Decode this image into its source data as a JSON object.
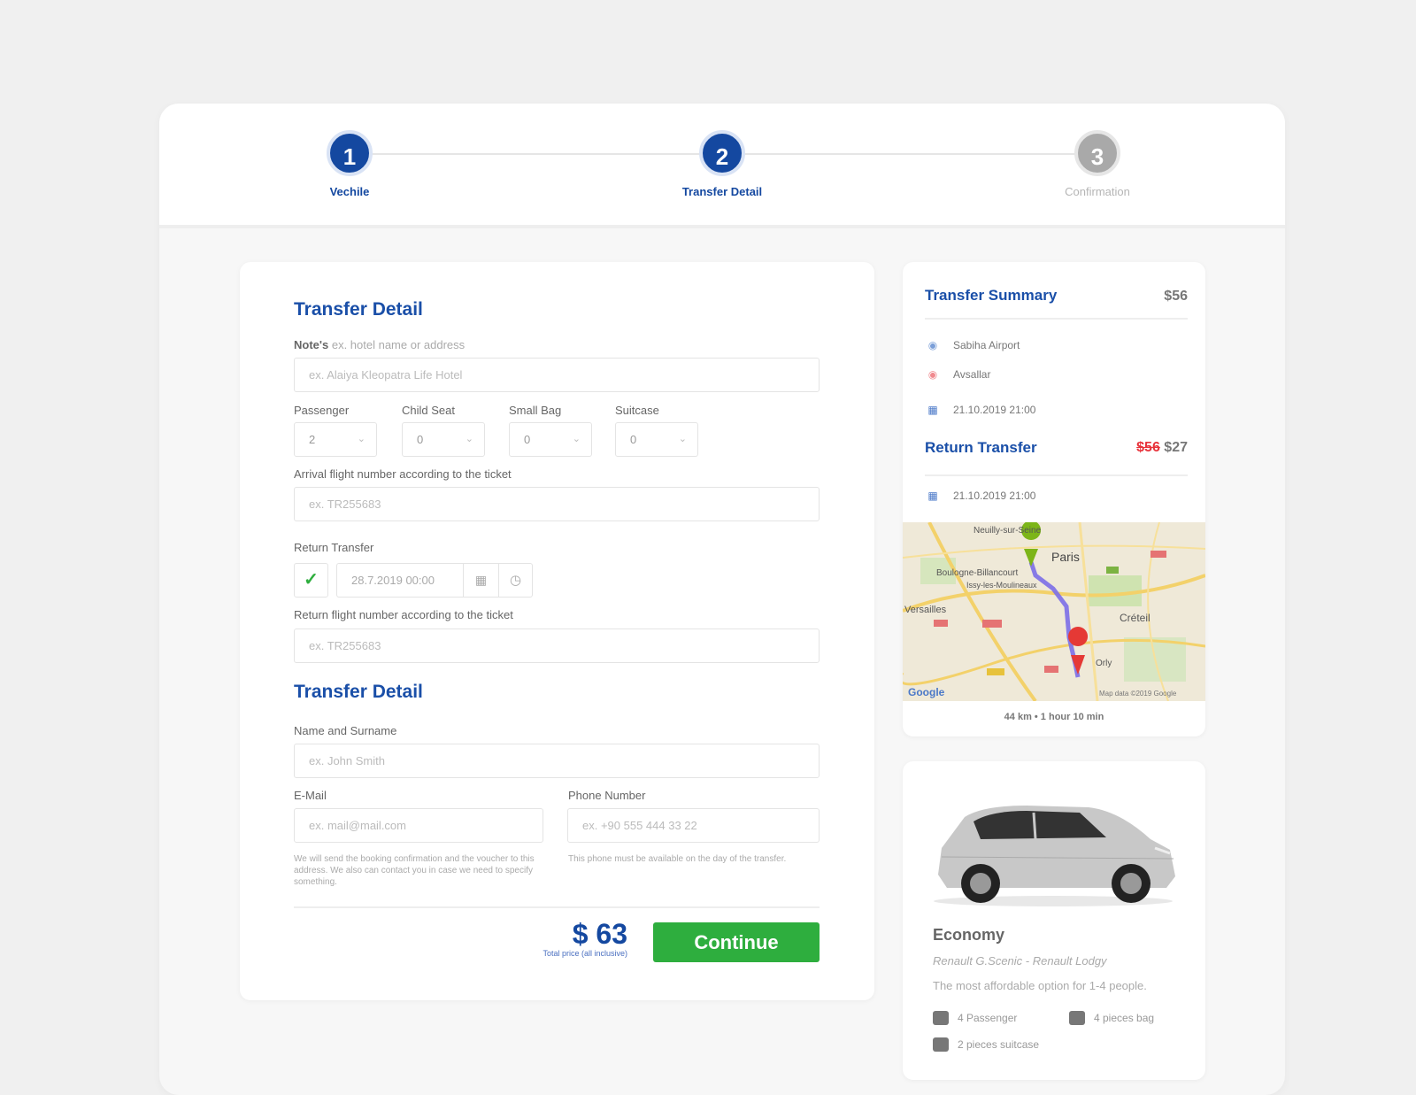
{
  "steps": [
    {
      "number": "1",
      "label": "Vechile",
      "state": "done"
    },
    {
      "number": "2",
      "label": "Transfer Detail",
      "state": "active"
    },
    {
      "number": "3",
      "label": "Confirmation",
      "state": "pending"
    }
  ],
  "form": {
    "title": "Transfer Detail",
    "notes_label": "Note's",
    "notes_hint": "ex. hotel name or address",
    "notes_placeholder": "ex. Alaiya Kleopatra Life Hotel",
    "passenger_label": "Passenger",
    "passenger_value": "2",
    "child_seat_label": "Child Seat",
    "child_seat_value": "0",
    "small_bag_label": "Small Bag",
    "small_bag_value": "0",
    "suitcase_label": "Suitcase",
    "suitcase_value": "0",
    "arrival_label": "Arrival flight number according to the ticket",
    "arrival_placeholder": "ex. TR255683",
    "return_label": "Return Transfer",
    "return_datetime": "28.7.2019 00:00",
    "return_flight_label": "Return flight number according to the ticket",
    "return_flight_placeholder": "ex. TR255683",
    "contact_title": "Transfer Detail",
    "name_label": "Name and Surname",
    "name_placeholder": "ex. John Smith",
    "email_label": "E-Mail",
    "email_placeholder": "ex. mail@mail.com",
    "email_help": "We will send the booking confirmation and the voucher to this address. We also can contact you in case we need to specify something.",
    "phone_label": "Phone Number",
    "phone_placeholder": "ex. +90 555 444 33 22",
    "phone_help": "This phone must be available on the day of the transfer.",
    "total_price": "$ 63",
    "total_note": "Total price (all inclusive)",
    "continue_label": "Continue"
  },
  "summary": {
    "title": "Transfer Summary",
    "price": "$56",
    "from": "Sabiha Airport",
    "to": "Avsallar",
    "date": "21.10.2019 21:00",
    "return_title": "Return Transfer",
    "return_old_price": "$56",
    "return_price": "$27",
    "return_date": "21.10.2019 21:00",
    "map_labels": {
      "paris": "Paris",
      "neuilly": "Neuilly-sur-Seine",
      "boulogne": "Boulogne-Billancourt",
      "issy": "Issy-les-Moulineaux",
      "versailles": "Versailles",
      "creteil": "Créteil",
      "orly": "Orly",
      "google": "Google",
      "map_credit": "Map data ©2019 Google"
    },
    "route_info": "44 km • 1 hour 10 min"
  },
  "vehicle": {
    "class": "Economy",
    "models": "Renault G.Scenic - Renault Lodgy",
    "description": "The most affordable option for 1-4 people.",
    "features": [
      "4 Passenger",
      "4 pieces bag",
      "2 pieces suitcase"
    ]
  },
  "colors": {
    "primary": "#1448a0",
    "green": "#2eae3e",
    "red": "#e8323a"
  }
}
